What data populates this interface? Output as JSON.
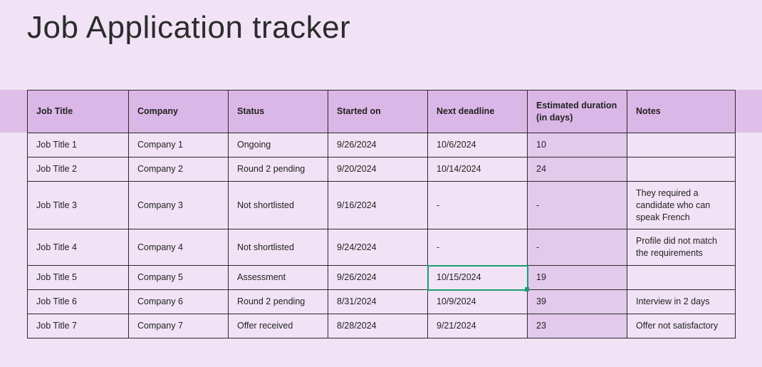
{
  "title": "Job Application tracker",
  "columns": [
    "Job Title",
    "Company",
    "Status",
    "Started on",
    "Next deadline",
    "Estimated duration (in days)",
    "Notes"
  ],
  "rows": [
    {
      "title": "Job Title 1",
      "company": "Company 1",
      "status": "Ongoing",
      "started": "9/26/2024",
      "next": "10/6/2024",
      "duration": "10",
      "notes": ""
    },
    {
      "title": "Job Title 2",
      "company": "Company 2",
      "status": "Round 2 pending",
      "started": "9/20/2024",
      "next": "10/14/2024",
      "duration": "24",
      "notes": ""
    },
    {
      "title": "Job Title 3",
      "company": "Company 3",
      "status": "Not shortlisted",
      "started": "9/16/2024",
      "next": "-",
      "duration": "-",
      "notes": "They required a candidate who can speak French"
    },
    {
      "title": "Job Title 4",
      "company": "Company 4",
      "status": "Not shortlisted",
      "started": "9/24/2024",
      "next": "-",
      "duration": "-",
      "notes": "Profile did not match the requirements"
    },
    {
      "title": "Job Title 5",
      "company": "Company 5",
      "status": "Assessment",
      "started": "9/26/2024",
      "next": "10/15/2024",
      "duration": "19",
      "notes": ""
    },
    {
      "title": "Job Title 6",
      "company": "Company 6",
      "status": "Round 2 pending",
      "started": "8/31/2024",
      "next": "10/9/2024",
      "duration": "39",
      "notes": "Interview in 2 days"
    },
    {
      "title": "Job Title 7",
      "company": "Company 7",
      "status": "Offer received",
      "started": "8/28/2024",
      "next": "9/21/2024",
      "duration": "23",
      "notes": "Offer not satisfactory"
    }
  ],
  "selected_cell": {
    "row": 4,
    "col": "next"
  }
}
